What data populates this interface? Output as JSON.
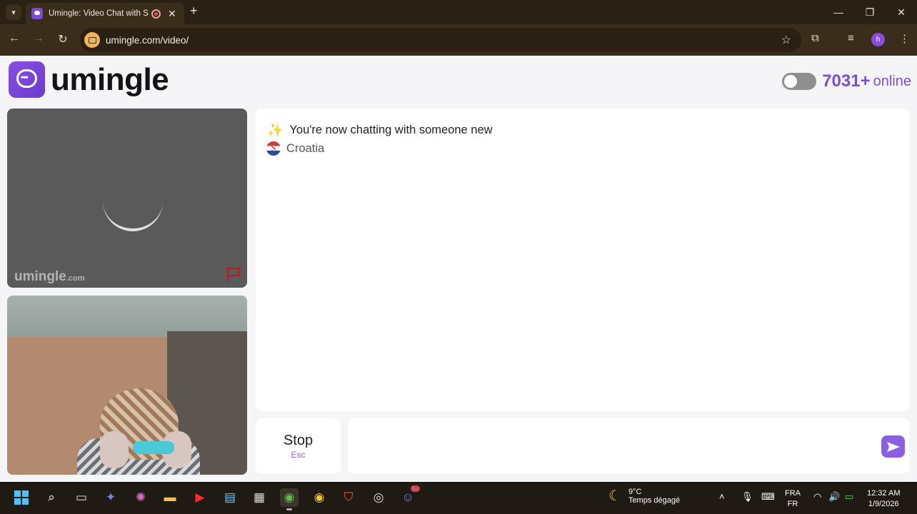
{
  "browser": {
    "tab_title": "Umingle: Video Chat with S",
    "url": "umingle.com/video/",
    "profile_initial": "h"
  },
  "header": {
    "logo_text": "umingle",
    "online_count": "7031+",
    "online_label": "online"
  },
  "remote_video": {
    "watermark": "umingle",
    "watermark_suffix": ".com"
  },
  "chat": {
    "status_message": "You're now chatting with someone new",
    "country": "Croatia"
  },
  "controls": {
    "stop_label": "Stop",
    "stop_shortcut": "Esc",
    "message_placeholder": ""
  },
  "taskbar": {
    "weather_temp": "9°C",
    "weather_desc": "Temps dégagé",
    "lang_top": "FRA",
    "lang_bottom": "FR",
    "time": "12:32 AM",
    "date": "1/9/2026",
    "notification_badge": "9+"
  },
  "colors": {
    "accent": "#7b4fd8",
    "browser_frame": "#3b2d1c"
  }
}
